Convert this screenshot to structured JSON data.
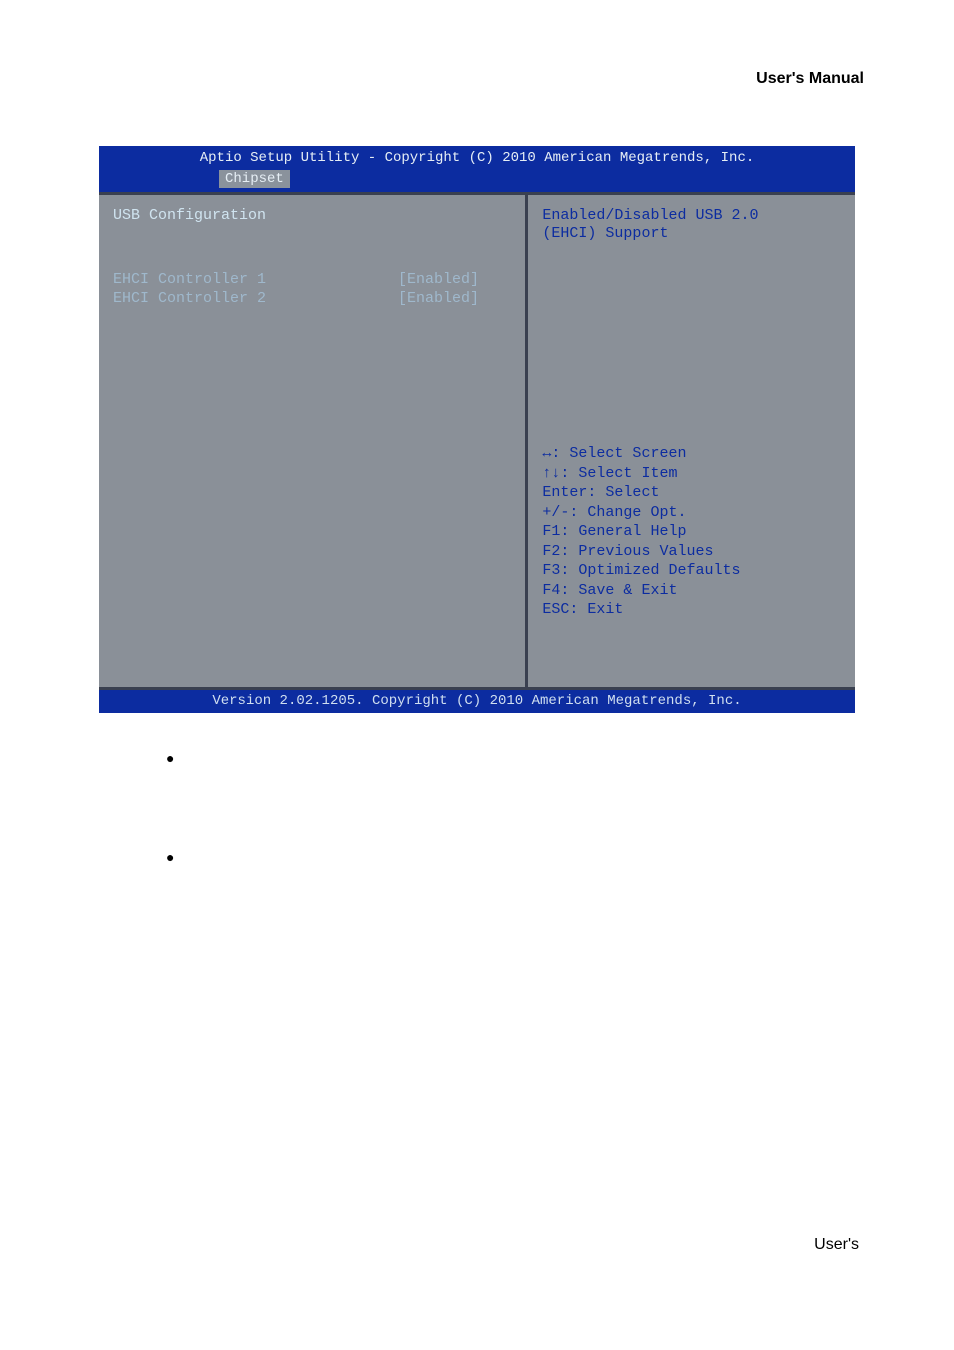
{
  "page_header": "User's  Manual",
  "bios": {
    "title_line": "Aptio Setup Utility - Copyright (C) 2010 American Megatrends, Inc.",
    "active_tab": "Chipset",
    "left": {
      "section": "USB Configuration",
      "options": [
        {
          "label": "EHCI Controller 1",
          "value": "[Enabled]"
        },
        {
          "label": "EHCI Controller 2",
          "value": "[Enabled]"
        }
      ]
    },
    "right": {
      "help1": "Enabled/Disabled USB 2.0",
      "help2": "(EHCI) Support",
      "nav": [
        "↔: Select Screen",
        "↑↓: Select Item",
        "Enter: Select",
        "+/-: Change Opt.",
        "F1: General Help",
        "F2: Previous Values",
        "F3: Optimized Defaults",
        "F4: Save & Exit",
        "ESC: Exit"
      ]
    },
    "footer": "Version 2.02.1205. Copyright (C) 2010 American Megatrends, Inc."
  },
  "page_footer": "User's"
}
